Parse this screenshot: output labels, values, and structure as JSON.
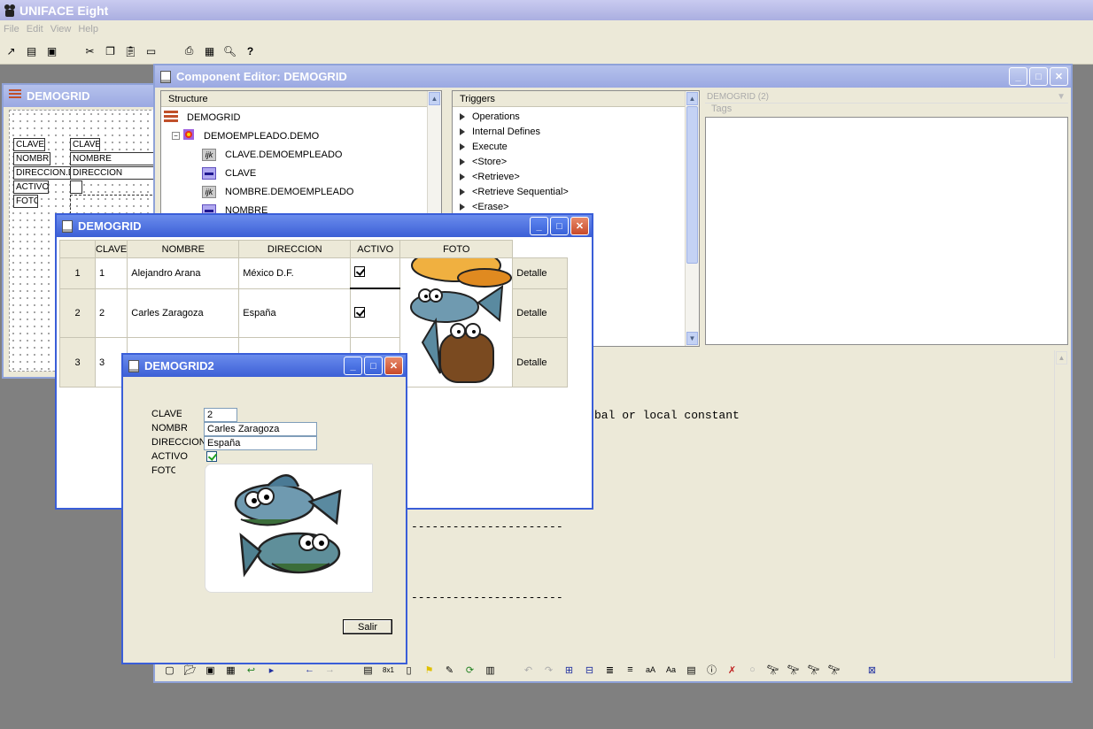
{
  "app": {
    "title": "UNIFACE Eight",
    "menu": [
      "File",
      "Edit",
      "View",
      "Help"
    ],
    "toolbar_icons": [
      "exit-icon",
      "window-icon",
      "save-icon",
      "cut-icon",
      "copy-icon",
      "paste-icon",
      "clear-icon",
      "print-icon",
      "print-setup-icon",
      "find-icon",
      "help-icon"
    ]
  },
  "component_editor": {
    "title": "Component Editor: DEMOGRID",
    "structure": {
      "header": "Structure",
      "items": [
        {
          "label": "DEMOGRID",
          "icon": "form-icon"
        },
        {
          "label": "DEMOEMPLEADO.DEMO",
          "icon": "entity-icon"
        },
        {
          "label": "CLAVE.DEMOEMPLEADO",
          "icon": "field-ijk-icon"
        },
        {
          "label": "CLAVE",
          "icon": "field-edit-icon"
        },
        {
          "label": "NOMBRE.DEMOEMPLEADO",
          "icon": "field-ijk-icon"
        },
        {
          "label": "NOMBRE",
          "icon": "field-edit-icon"
        }
      ]
    },
    "triggers": {
      "header": "Triggers",
      "items": [
        "Operations",
        "Internal Defines",
        "Execute",
        "<Store>",
        "<Retrieve>",
        "<Retrieve Sequential>",
        "<Erase>"
      ]
    },
    "tags": {
      "selector": "DEMOGRID (2)",
      "header": "Tags"
    },
    "code_lines": [
      "bal or local constant",
      "----------------------",
      "----------------------"
    ]
  },
  "demogrid_design": {
    "title": "DEMOGRID",
    "labels": [
      "CLAVE",
      "NOMBRE",
      "DIRECCION.DEMO",
      "ACTIVO",
      "FOTO"
    ],
    "fields": [
      "CLAVE",
      "NOMBRE",
      "DIRECCION"
    ]
  },
  "demogrid": {
    "title": "DEMOGRID",
    "columns": [
      "CLAVE",
      "NOMBRE",
      "DIRECCION",
      "ACTIVO",
      "FOTO"
    ],
    "rows": [
      {
        "num": "1",
        "clave": "1",
        "nombre": "Alejandro Arana",
        "direccion": "México D.F.",
        "activo": true,
        "detail": "Detalle"
      },
      {
        "num": "2",
        "clave": "2",
        "nombre": "Carles Zaragoza",
        "direccion": "España",
        "activo": true,
        "detail": "Detalle"
      },
      {
        "num": "3",
        "clave": "3",
        "nombre": "",
        "direccion": "",
        "activo": false,
        "detail": "Detalle"
      }
    ]
  },
  "demogrid2": {
    "title": "DEMOGRID2",
    "labels": {
      "clave": "CLAVE",
      "nombre": "NOMBRE",
      "direccion": "DIRECCION",
      "activo": "ACTIVO",
      "foto": "FOTO"
    },
    "values": {
      "clave": "2",
      "nombre": "Carles Zaragoza",
      "direccion": "España",
      "activo": true
    },
    "exit_button": "Salir"
  }
}
